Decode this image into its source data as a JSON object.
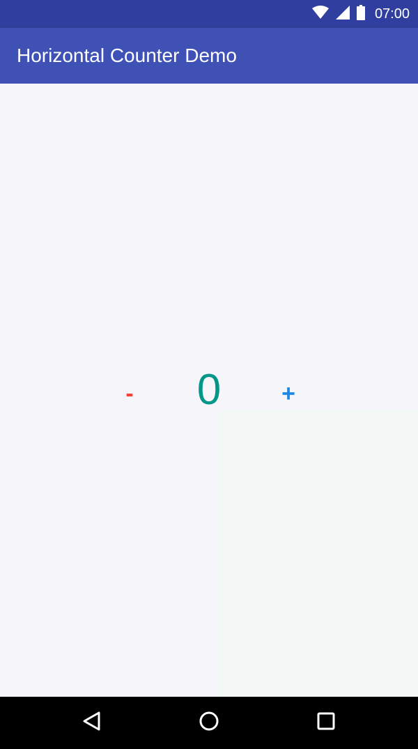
{
  "status_bar": {
    "time": "07:00",
    "icons": [
      "wifi-icon",
      "signal-icon",
      "battery-icon"
    ]
  },
  "app_bar": {
    "title": "Horizontal Counter Demo",
    "color": "#3f51b5"
  },
  "counter": {
    "minus_label": "-",
    "plus_label": "+",
    "value": "0",
    "colors": {
      "minus": "#f44336",
      "value": "#009688",
      "plus": "#1e88e5"
    }
  },
  "nav_bar": {
    "buttons": [
      "back-icon",
      "home-icon",
      "recents-icon"
    ]
  }
}
